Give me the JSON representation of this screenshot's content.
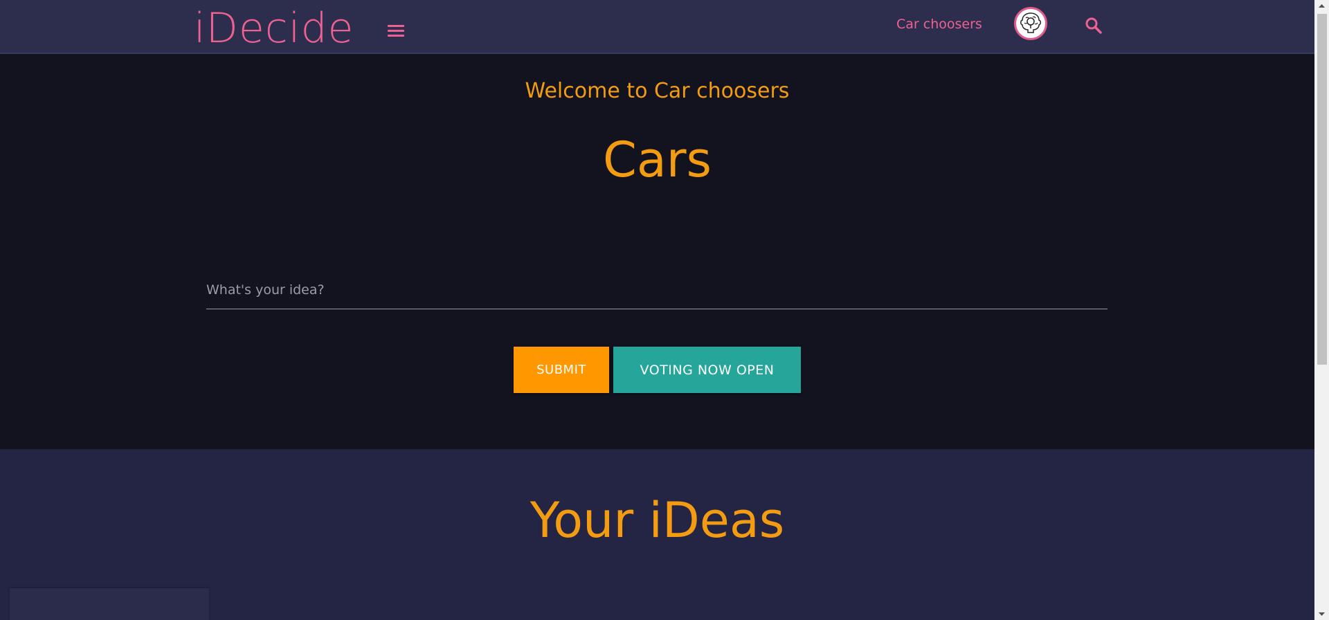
{
  "navbar": {
    "brand": "iDecide",
    "menu_icon": "hamburger-menu-icon",
    "group_link": "Car choosers",
    "avatar_icon": "lightbulb-brain-icon",
    "search_icon": "search-icon"
  },
  "hero": {
    "welcome_text": "Welcome to Car choosers",
    "title": "Cars",
    "idea_placeholder": "What's your idea?",
    "submit_label": "SUBMIT",
    "voting_label": "VOTING NOW OPEN"
  },
  "ideas_section": {
    "title": "Your iDeas"
  },
  "colors": {
    "brand_pink": "#ee6292",
    "accent_orange": "#f39c12",
    "submit_orange": "#ff9800",
    "voting_teal": "#26a69a",
    "navbar_bg": "#2d2e4d",
    "hero_bg": "#12131f",
    "section_bg": "#242545"
  }
}
